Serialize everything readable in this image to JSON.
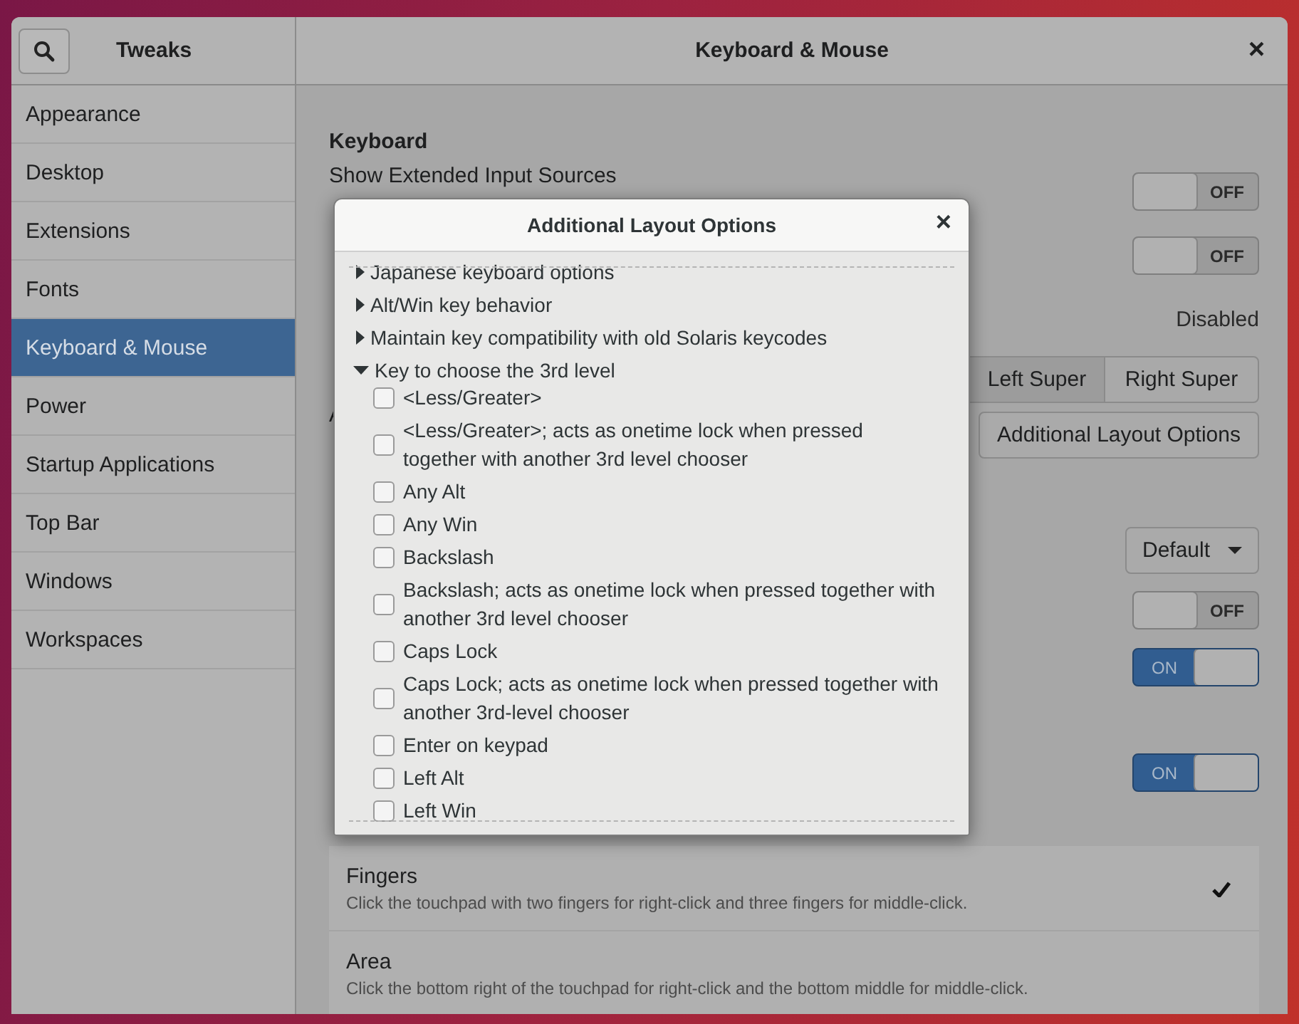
{
  "header": {
    "sidebar_title": "Tweaks",
    "title": "Keyboard & Mouse",
    "close": "×"
  },
  "sidebar": {
    "items": [
      {
        "label": "Appearance",
        "selected": false
      },
      {
        "label": "Desktop",
        "selected": false
      },
      {
        "label": "Extensions",
        "selected": false
      },
      {
        "label": "Fonts",
        "selected": false
      },
      {
        "label": "Keyboard & Mouse",
        "selected": true
      },
      {
        "label": "Power",
        "selected": false
      },
      {
        "label": "Startup Applications",
        "selected": false
      },
      {
        "label": "Top Bar",
        "selected": false
      },
      {
        "label": "Windows",
        "selected": false
      },
      {
        "label": "Workspaces",
        "selected": false
      }
    ]
  },
  "content": {
    "heading": "Keyboard",
    "settings": [
      {
        "kind": "switch",
        "label": "Show Extended Input Sources",
        "on": false,
        "state_text": "OFF"
      },
      {
        "kind": "switch",
        "on": false,
        "state_text": "OFF"
      },
      {
        "kind": "value",
        "text": "Disabled"
      },
      {
        "kind": "segmented",
        "options": [
          {
            "label": "Left Super",
            "selected": true
          },
          {
            "label": "Right Super",
            "selected": false
          }
        ]
      },
      {
        "kind": "button",
        "label": "Additional Layout Options"
      },
      {
        "kind": "dropdown",
        "value": "Default"
      },
      {
        "kind": "switch",
        "on": false,
        "state_text": "OFF"
      },
      {
        "kind": "switch",
        "on": true,
        "state_text": "ON"
      },
      {
        "kind": "switch",
        "on": true,
        "state_text": "ON"
      }
    ],
    "click_methods": [
      {
        "title": "Fingers",
        "description": "Click the touchpad with two fingers for right-click and three fingers for middle-click.",
        "selected": true
      },
      {
        "title": "Area",
        "description": "Click the bottom right of the touchpad for right-click and the bottom middle for middle-click.",
        "selected": false
      }
    ]
  },
  "dialog": {
    "title": "Additional Layout Options",
    "close": "×",
    "options": [
      {
        "label": "Japanese keyboard options",
        "expanded": false
      },
      {
        "label": "Alt/Win key behavior",
        "expanded": false
      },
      {
        "label": "Maintain key compatibility with old Solaris keycodes",
        "expanded": false
      },
      {
        "label": "Key to choose the 3rd level",
        "expanded": true,
        "children": [
          {
            "label": "<Less/Greater>",
            "checked": false
          },
          {
            "label": "<Less/Greater>; acts as onetime lock when pressed together with another 3rd level chooser",
            "checked": false
          },
          {
            "label": "Any Alt",
            "checked": false
          },
          {
            "label": "Any Win",
            "checked": false
          },
          {
            "label": "Backslash",
            "checked": false
          },
          {
            "label": "Backslash; acts as onetime lock when pressed together with another 3rd level chooser",
            "checked": false
          },
          {
            "label": "Caps Lock",
            "checked": false
          },
          {
            "label": "Caps Lock; acts as onetime lock when pressed together with another 3rd-level chooser",
            "checked": false
          },
          {
            "label": "Enter on keypad",
            "checked": false
          },
          {
            "label": "Left Alt",
            "checked": false
          },
          {
            "label": "Left Win",
            "checked": false
          }
        ]
      }
    ]
  }
}
